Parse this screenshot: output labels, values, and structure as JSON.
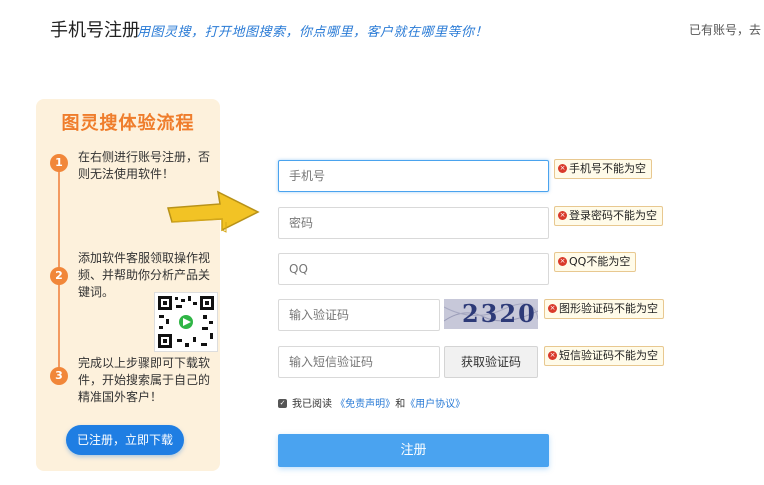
{
  "header": {
    "title": "手机号注册",
    "slogan": "用图灵搜，打开地图搜索，你点哪里，客户就在哪里等你！",
    "login_hint": "已有账号，去"
  },
  "guide": {
    "title": "图灵搜体验流程",
    "steps": [
      {
        "num": "1",
        "text": "在右侧进行账号注册，否则无法使用软件！"
      },
      {
        "num": "2",
        "text": "添加软件客服领取操作视频、并帮助你分析产品关键词。"
      },
      {
        "num": "3",
        "text": "完成以上步骤即可下载软件，开始搜索属于自己的精准国外客户！"
      }
    ],
    "cta_label": "已注册，立即下载"
  },
  "form": {
    "phone_placeholder": "手机号",
    "password_placeholder": "密码",
    "qq_placeholder": "QQ",
    "captcha_placeholder": "输入验证码",
    "captcha_text": "2320",
    "sms_placeholder": "输入短信验证码",
    "sms_button": "获取验证码",
    "errors": {
      "phone": "手机号不能为空",
      "password": "登录密码不能为空",
      "qq": "QQ不能为空",
      "captcha": "图形验证码不能为空",
      "sms": "短信验证码不能为空"
    },
    "agreement": {
      "prefix": "我已阅读",
      "disclaimer": "《免责声明》",
      "and": "和",
      "user_agreement": "《用户协议》"
    },
    "submit_label": "注册"
  },
  "colors": {
    "accent": "#4aa3f0",
    "guide_bg": "#fdf1dc",
    "guide_accent": "#ef7d2c",
    "error_icon": "#d93a2b"
  }
}
